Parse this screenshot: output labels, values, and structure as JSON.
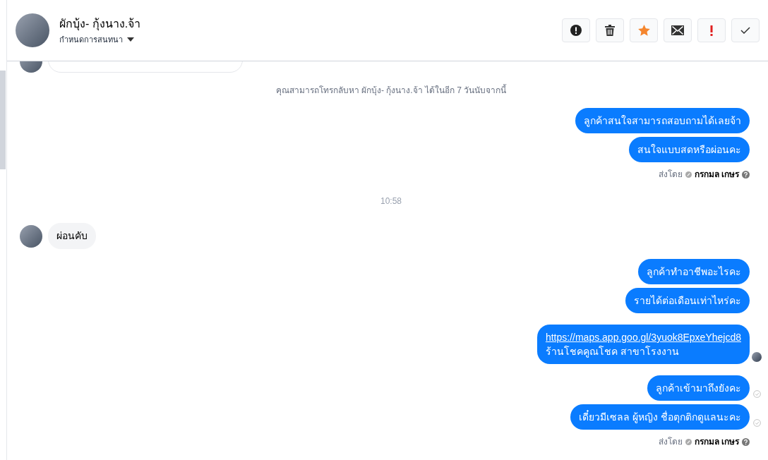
{
  "header": {
    "name": "ผักบุ้ง- กุ้งนาง.จ้า",
    "subtitle": "กำหนดการสนทนา"
  },
  "actions": [
    {
      "kind": "report"
    },
    {
      "kind": "delete"
    },
    {
      "kind": "star"
    },
    {
      "kind": "mail"
    },
    {
      "kind": "important"
    },
    {
      "kind": "done"
    }
  ],
  "messages": [
    {
      "kind": "clipped"
    },
    {
      "kind": "notice",
      "text": "คุณสามารถโทรกลับหา ผักบุ้ง- กุ้งนาง.จ้า ได้ในอีก 7 วันนับจากนี้"
    },
    {
      "kind": "out",
      "text": "ลูกค้าสนใจสามารถสอบถามได้เลยจ้า",
      "seen": false,
      "delivered": false
    },
    {
      "kind": "out",
      "text": "สนใจแบบสดหรือผ่อนคะ",
      "seen": false,
      "delivered": false
    },
    {
      "kind": "sent_by",
      "label": "ส่งโดย",
      "agent": "กรกมล เกษร"
    },
    {
      "kind": "time",
      "text": "10:58"
    },
    {
      "kind": "in",
      "text": "ผ่อนคับ"
    },
    {
      "kind": "out",
      "text": "ลูกค้าทำอาชีพอะไรคะ",
      "seen": false,
      "delivered": false
    },
    {
      "kind": "out",
      "text": "รายได้ต่อเดือนเท่าไหร่คะ",
      "seen": false,
      "delivered": false
    },
    {
      "kind": "out",
      "link": "https://maps.app.goo.gl/3yuok8EpxeYhejcd8",
      "text": "ร้านโชคคูณโชค สาขาโรงงาน",
      "seen": true,
      "delivered": false
    },
    {
      "kind": "out",
      "text": "ลูกค้าเข้ามาถึงยังคะ",
      "seen": false,
      "delivered": true
    },
    {
      "kind": "out",
      "text": "เดี๋ยวมีเซลล ผู้หญิง ชื่อตุกติกดูแลนะคะ",
      "seen": false,
      "delivered": true
    },
    {
      "kind": "sent_by",
      "label": "ส่งโดย",
      "agent": "กรกมล เกษร"
    }
  ]
}
